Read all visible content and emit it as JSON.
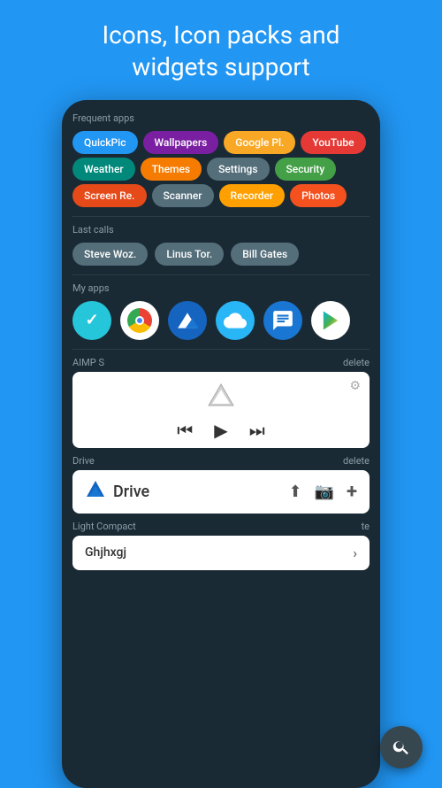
{
  "header": {
    "line1": "Icons, Icon packs and",
    "line2": "widgets support"
  },
  "phone": {
    "frequent_apps_label": "Frequent apps",
    "chips_row1": [
      {
        "label": "QuickPic",
        "color": "chip-blue"
      },
      {
        "label": "Wallpapers",
        "color": "chip-purple"
      },
      {
        "label": "Google Pl.",
        "color": "chip-yellow"
      },
      {
        "label": "YouTube",
        "color": "chip-red"
      }
    ],
    "chips_row2": [
      {
        "label": "Weather",
        "color": "chip-teal"
      },
      {
        "label": "Themes",
        "color": "chip-orange"
      },
      {
        "label": "Settings",
        "color": "chip-gray"
      },
      {
        "label": "Security",
        "color": "chip-green"
      }
    ],
    "chips_row3": [
      {
        "label": "Screen Re.",
        "color": "chip-deep-orange"
      },
      {
        "label": "Scanner",
        "color": "chip-gray"
      },
      {
        "label": "Recorder",
        "color": "chip-amber"
      },
      {
        "label": "Photos",
        "color": "chip-amber"
      }
    ],
    "last_calls_label": "Last calls",
    "contacts": [
      {
        "label": "Steve Woz."
      },
      {
        "label": "Linus Tor."
      },
      {
        "label": "Bill Gates"
      }
    ],
    "my_apps_label": "My apps",
    "app_icons": [
      {
        "name": "aimp",
        "color": "app-check"
      },
      {
        "name": "chrome",
        "color": "app-chrome"
      },
      {
        "name": "mountains",
        "color": "app-blue"
      },
      {
        "name": "cloud",
        "color": "app-light-blue"
      },
      {
        "name": "messages",
        "color": "app-message"
      },
      {
        "name": "play-store",
        "color": "app-play"
      }
    ],
    "widget1_label": "AIMP S",
    "widget1_delete": "delete",
    "widget2_label": "Drive",
    "widget2_delete": "delete",
    "widget2_title": "Drive",
    "widget3_label": "Light Compact",
    "widget3_delete": "te",
    "widget3_content": "Ghjhxgj"
  },
  "fab": {
    "icon": "search"
  }
}
